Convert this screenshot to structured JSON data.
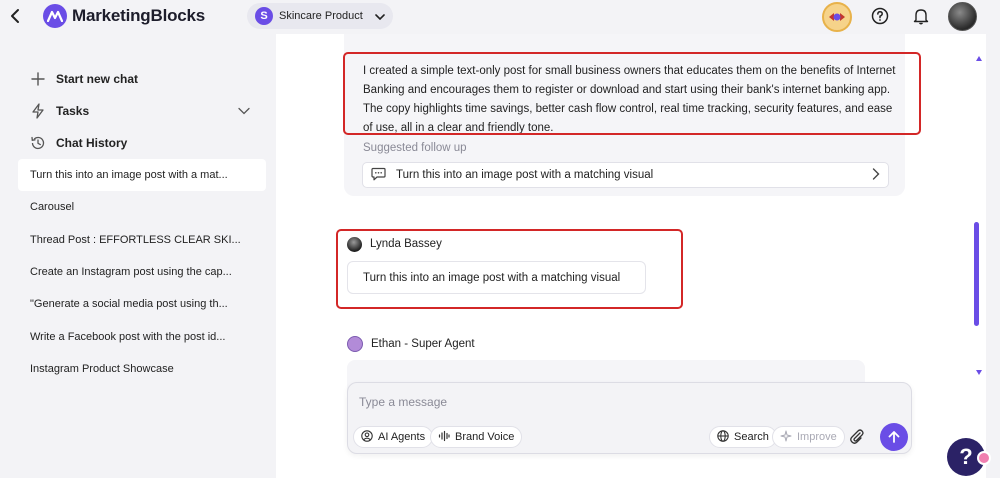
{
  "header": {
    "logo_text": "MarketingBlocks",
    "workspace_initial": "S",
    "workspace_name": "Skincare Product"
  },
  "sidebar": {
    "start_new_chat": "Start new chat",
    "tasks": "Tasks",
    "chat_history": "Chat History",
    "history": [
      "Turn this into an image post with a mat...",
      "Carousel",
      "Thread Post : EFFORTLESS CLEAR SKI...",
      "Create an Instagram post using the cap...",
      "\"Generate a social media post using th...",
      "Write a Facebook post with the post id...",
      "Instagram Product Showcase"
    ]
  },
  "chat": {
    "ai_message": "I created a simple text-only post for small business owners that educates them on the benefits of Internet Banking and encourages them to register or download and start using their bank's internet banking app. The copy highlights time savings, better cash flow control, real time tracking, security features, and ease of use, all in a clear and friendly tone.",
    "suggested_label": "Suggested follow up",
    "suggested_text": "Turn this into an image post with a matching visual",
    "user_name": "Lynda Bassey",
    "user_message": "Turn this into an image post with a matching visual",
    "agent_name": "Ethan - Super Agent"
  },
  "composer": {
    "placeholder": "Type a message",
    "ai_agents": "AI Agents",
    "brand_voice": "Brand Voice",
    "search": "Search",
    "improve": "Improve"
  },
  "help": {
    "fab_glyph": "?"
  },
  "colors": {
    "accent": "#6a4de6",
    "highlight_box": "#d32727"
  }
}
